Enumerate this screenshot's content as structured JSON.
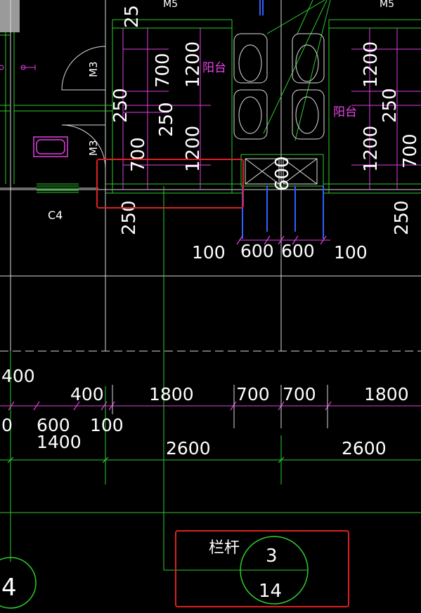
{
  "drawing": {
    "background": "#000000",
    "colors": {
      "wall": "#d9d9d9",
      "axis_green": "#2ecc2e",
      "dim_magenta": "#e040e0",
      "text_white": "#ffffff",
      "text_magenta": "#e844e8",
      "fixture": "#e0e0e0",
      "highlight_red": "#e02020",
      "blue": "#3060ff",
      "cyan": "#40d0d0"
    },
    "labels": {
      "m5_left": "M5",
      "m5_right": "M5",
      "m3_upper": "M3",
      "m3_lower": "M3",
      "c4": "C4",
      "balcony_left": "阳台",
      "balcony_right": "阳台",
      "railing": "栏杆",
      "detail_top": "3",
      "detail_bottom": "14",
      "axis_left": "4"
    },
    "vertical_dims": {
      "d250_top": "25",
      "d700_a": "700",
      "d1200_a": "1200",
      "d250_b": "250",
      "d250_c": "250",
      "d700_b": "700",
      "d1200_b": "1200",
      "d250_d": "250",
      "d600": "600",
      "d1200_c": "1200",
      "d250_e": "250",
      "d1200_d": "1200",
      "d700_c": "700",
      "d250_f": "250"
    },
    "horizontal_dims": {
      "row1": [
        "100",
        "600",
        "600",
        "100"
      ],
      "row2_left": "400",
      "row3": [
        "400",
        "1800",
        "700",
        "700",
        "1800"
      ],
      "row4": [
        "0",
        "600",
        "100"
      ],
      "row4b": "1400",
      "row5": [
        "2600",
        "2600"
      ]
    }
  }
}
